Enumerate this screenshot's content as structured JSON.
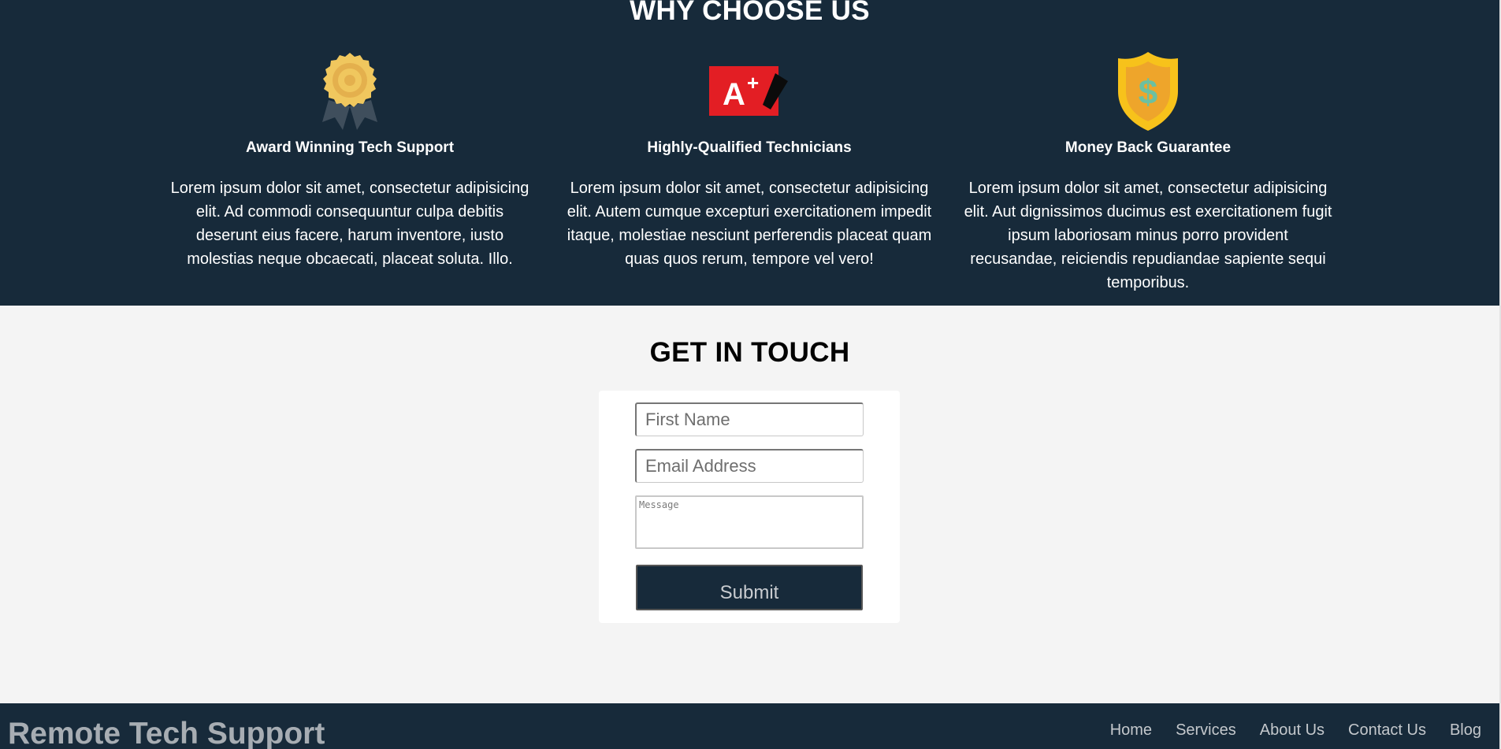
{
  "why_section": {
    "title": "WHY CHOOSE US",
    "features": [
      {
        "icon": "award-medal-icon",
        "title": "Award Winning Tech Support",
        "text": "Lorem ipsum dolor sit amet, consectetur adipisicing elit. Ad commodi consequuntur culpa debitis deserunt eius facere, harum inventore, iusto molestias neque obcaecati, placeat soluta. Illo."
      },
      {
        "icon": "a-plus-grade-icon",
        "title": "Highly-Qualified Technicians",
        "text": "Lorem ipsum dolor sit amet, consectetur adipisicing elit. Autem cumque excepturi exercitationem impedit itaque, molestiae nesciunt perferendis placeat quam quas quos rerum, tempore vel vero!"
      },
      {
        "icon": "dollar-shield-icon",
        "title": "Money Back Guarantee",
        "text": "Lorem ipsum dolor sit amet, consectetur adipisicing elit. Aut dignissimos ducimus est exercitationem fugit ipsum laboriosam minus porro provident recusandae, reiciendis repudiandae sapiente sequi temporibus."
      }
    ]
  },
  "contact_section": {
    "title": "GET IN TOUCH",
    "form": {
      "first_name_placeholder": "First Name",
      "first_name_value": "",
      "email_placeholder": "Email Address",
      "email_value": "",
      "message_placeholder": "Message",
      "message_value": "",
      "submit_label": "Submit"
    }
  },
  "footer": {
    "brand": "Remote Tech Support",
    "nav": [
      "Home",
      "Services",
      "About Us",
      "Contact Us",
      "Blog"
    ]
  },
  "colors": {
    "navy": "#172a3a",
    "page_background": "#f4f4f4",
    "medal_gold": "#f0c75e",
    "grade_red": "#e31e24",
    "shield_yellow": "#f7c21b",
    "dollar_green": "#6cc0a0"
  }
}
